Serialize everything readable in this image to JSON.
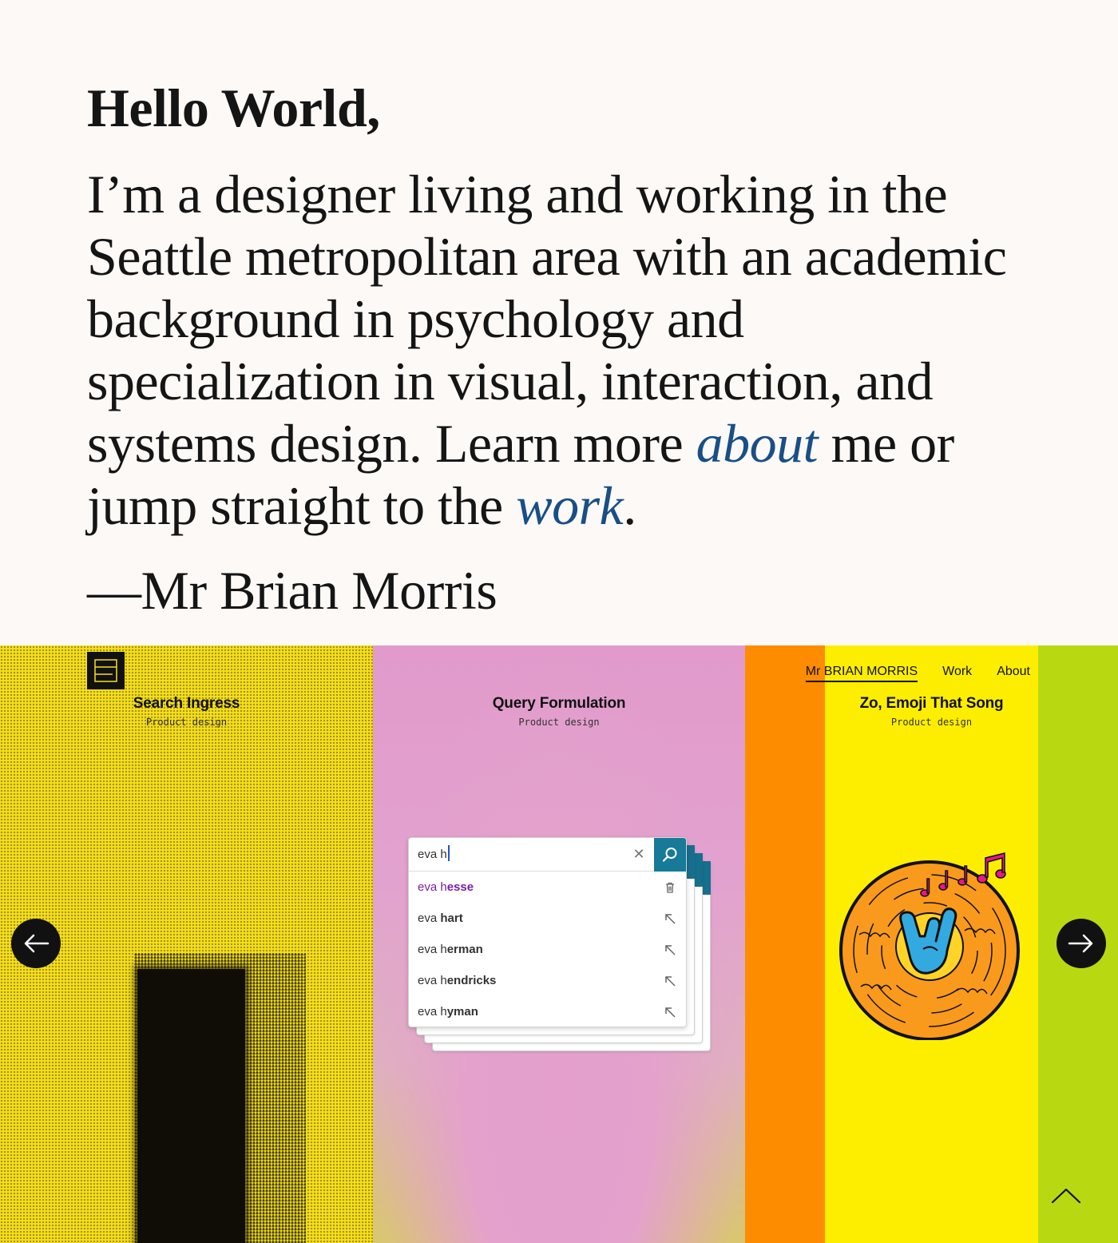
{
  "intro": {
    "greeting": "Hello World,",
    "bio_before_about": "I’m a designer living and working in the Seattle metropolitan area with an academic background in psychology and specialization in visual, interaction, and systems design. Learn more ",
    "about_link": "about",
    "bio_middle": " me or jump straight to the ",
    "work_link": "work",
    "bio_end": ".",
    "signature": "—Mr Brian Morris"
  },
  "nav": {
    "brand": "Mr BRIAN MORRIS",
    "work": "Work",
    "about": "About"
  },
  "projects": [
    {
      "title": "Search Ingress",
      "category": "Product design"
    },
    {
      "title": "Query Formulation",
      "category": "Product design"
    },
    {
      "title": "Zo, Emoji That Song",
      "category": "Product design"
    }
  ],
  "search_widget": {
    "query": "eva h",
    "suggestions": [
      {
        "prefix": "eva h",
        "completion": "esse",
        "icon": "trash-icon",
        "visited": true
      },
      {
        "prefix": "eva ",
        "completion": "hart",
        "icon": "arrow-up-left-icon",
        "visited": false
      },
      {
        "prefix": "eva h",
        "completion": "erman",
        "icon": "arrow-up-left-icon",
        "visited": false
      },
      {
        "prefix": "eva h",
        "completion": "endricks",
        "icon": "arrow-up-left-icon",
        "visited": false
      },
      {
        "prefix": "eva h",
        "completion": "yman",
        "icon": "arrow-up-left-icon",
        "visited": false
      }
    ]
  },
  "colors": {
    "link": "#184f86",
    "yellow": "#f7e01c",
    "orange": "#fd8c00",
    "lime": "#b8d912",
    "search_teal": "#177a98"
  }
}
